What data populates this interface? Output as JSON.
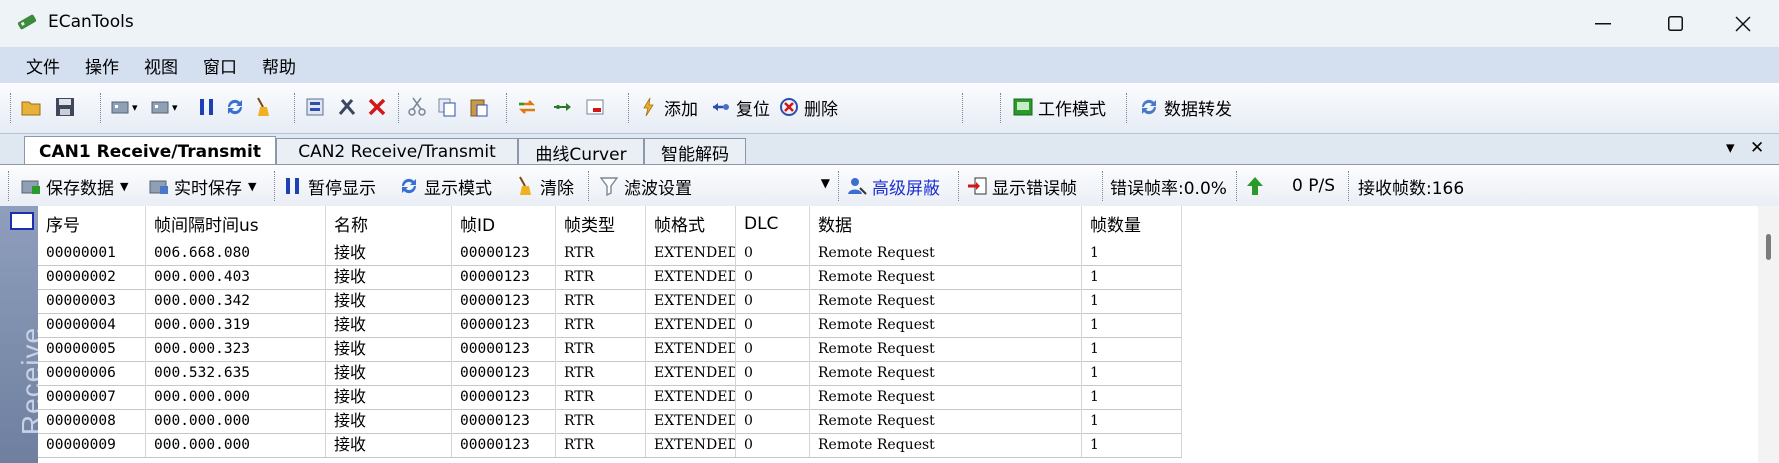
{
  "window": {
    "title": "ECanTools",
    "minimize": "—",
    "maximize": "☐",
    "close": "✕"
  },
  "menu": [
    "文件",
    "操作",
    "视图",
    "窗口",
    "帮助"
  ],
  "toolbar": {
    "add_label": "添加",
    "reset_label": "复位",
    "delete_label": "删除",
    "work_mode_label": "工作模式",
    "data_forward_label": "数据转发"
  },
  "tabs": [
    {
      "label": "CAN1 Receive/Transmit",
      "active": true
    },
    {
      "label": "CAN2 Receive/Transmit",
      "active": false
    },
    {
      "label": "曲线Curver",
      "active": false
    },
    {
      "label": "智能解码",
      "active": false
    }
  ],
  "tab_controls": {
    "dropdown": "▾",
    "close": "✕"
  },
  "subtoolbar": {
    "save_data": "保存数据",
    "realtime_save": "实时保存",
    "pause_display": "暂停显示",
    "display_mode": "显示模式",
    "clear": "清除",
    "filter_settings": "滤波设置",
    "advanced_mask": "高级屏蔽",
    "show_error_frames": "显示错误帧",
    "error_rate": "错误帧率:0.0%",
    "rate": "0 P/S",
    "received_frames": "接收帧数:166"
  },
  "side_panel": {
    "label": "Receive"
  },
  "table": {
    "columns": [
      "序号",
      "帧间隔时间us",
      "名称",
      "帧ID",
      "帧类型",
      "帧格式",
      "DLC",
      "数据",
      "帧数量"
    ],
    "rows": [
      [
        "00000001",
        "006.668.080",
        "接收",
        "00000123",
        "RTR",
        "EXTENDED",
        "0",
        "Remote Request",
        "1"
      ],
      [
        "00000002",
        "000.000.403",
        "接收",
        "00000123",
        "RTR",
        "EXTENDED",
        "0",
        "Remote Request",
        "1"
      ],
      [
        "00000003",
        "000.000.342",
        "接收",
        "00000123",
        "RTR",
        "EXTENDED",
        "0",
        "Remote Request",
        "1"
      ],
      [
        "00000004",
        "000.000.319",
        "接收",
        "00000123",
        "RTR",
        "EXTENDED",
        "0",
        "Remote Request",
        "1"
      ],
      [
        "00000005",
        "000.000.323",
        "接收",
        "00000123",
        "RTR",
        "EXTENDED",
        "0",
        "Remote Request",
        "1"
      ],
      [
        "00000006",
        "000.532.635",
        "接收",
        "00000123",
        "RTR",
        "EXTENDED",
        "0",
        "Remote Request",
        "1"
      ],
      [
        "00000007",
        "000.000.000",
        "接收",
        "00000123",
        "RTR",
        "EXTENDED",
        "0",
        "Remote Request",
        "1"
      ],
      [
        "00000008",
        "000.000.000",
        "接收",
        "00000123",
        "RTR",
        "EXTENDED",
        "0",
        "Remote Request",
        "1"
      ],
      [
        "00000009",
        "000.000.000",
        "接收",
        "00000123",
        "RTR",
        "EXTENDED",
        "0",
        "Remote Request",
        "1"
      ]
    ]
  },
  "colors": {
    "accent": "#1d2fd1",
    "menubar": "#d4dff0",
    "green": "#2a9a2a",
    "red": "#d01818"
  }
}
